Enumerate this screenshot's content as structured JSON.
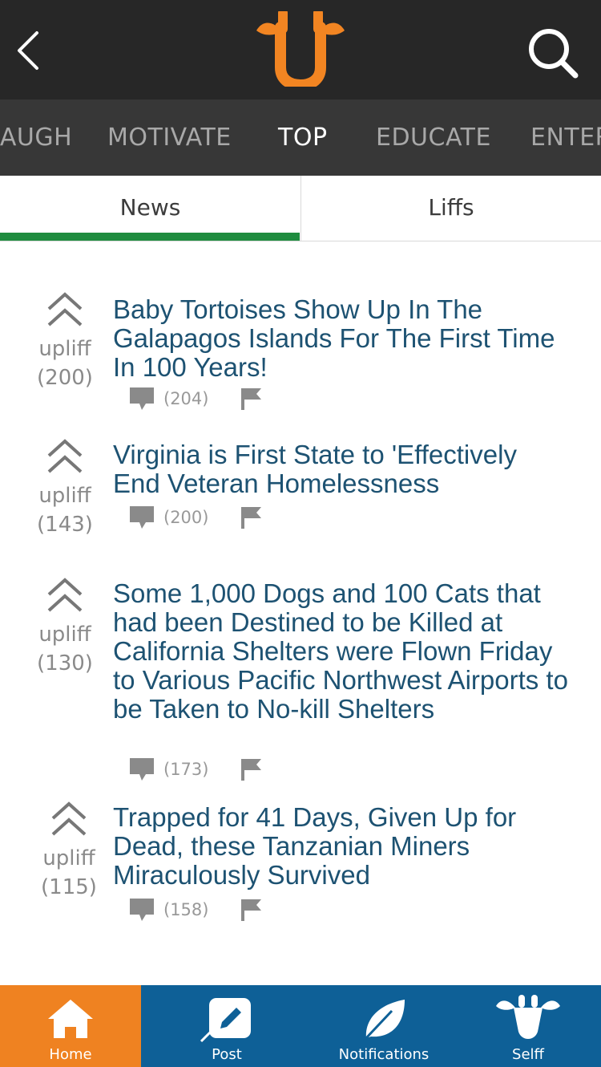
{
  "header": {
    "back_icon": "chevron-left-icon",
    "logo": "uplifff-giraffe-logo",
    "search_icon": "search-icon",
    "logo_color": "#f28522"
  },
  "categories": [
    {
      "label": "LAUGH",
      "active": false
    },
    {
      "label": "MOTIVATE",
      "active": false
    },
    {
      "label": "TOP",
      "active": true
    },
    {
      "label": "EDUCATE",
      "active": false
    },
    {
      "label": "ENTERTAIN",
      "active": false
    }
  ],
  "subtabs": [
    {
      "label": "News",
      "active": true
    },
    {
      "label": "Liffs",
      "active": false
    }
  ],
  "articles": [
    {
      "vote_label": "upliff",
      "vote_count": "(200)",
      "title": "Baby Tortoises Show Up In The Galapagos Islands For The First Time In 100 Years!",
      "comments": "(204)"
    },
    {
      "vote_label": "upliff",
      "vote_count": "(143)",
      "title": "Virginia is First State to 'Effectively End Veteran Homelessness",
      "comments": "(200)"
    },
    {
      "vote_label": "upliff",
      "vote_count": "(130)",
      "title": "Some 1,000 Dogs and 100 Cats that had been Destined to be Killed at California Shelters were Flown Friday to Various Pacific Northwest Airports to be Taken to No-kill Shelters",
      "comments": "(173)"
    },
    {
      "vote_label": "upliff",
      "vote_count": "(115)",
      "title": "Trapped for 41 Days, Given Up for Dead, these Tanzanian Miners Miraculously Survived",
      "comments": "(158)"
    }
  ],
  "bottom_nav": [
    {
      "label": "Home",
      "icon": "home-icon",
      "active": true
    },
    {
      "label": "Post",
      "icon": "pencil-icon",
      "active": false
    },
    {
      "label": "Notifications",
      "icon": "leaf-icon",
      "active": false
    },
    {
      "label": "Selff",
      "icon": "giraffe-icon",
      "active": false
    }
  ],
  "colors": {
    "accent_orange": "#ef8221",
    "nav_blue": "#0e6097",
    "tab_green": "#1f8c3f",
    "headline_blue": "#1d5272"
  }
}
